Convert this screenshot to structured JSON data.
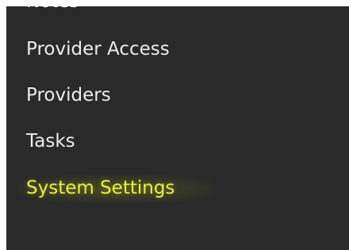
{
  "sidebar": {
    "items": [
      {
        "label": "Notes"
      },
      {
        "label": "Provider Access"
      },
      {
        "label": "Providers"
      },
      {
        "label": "Tasks"
      },
      {
        "label": "System Settings"
      }
    ],
    "active_label": "System Settings"
  },
  "colors": {
    "panel_background": "#2a2a2a",
    "text": "#ececec",
    "active_text": "#e7ef3a",
    "page_background": "#ffffff"
  }
}
